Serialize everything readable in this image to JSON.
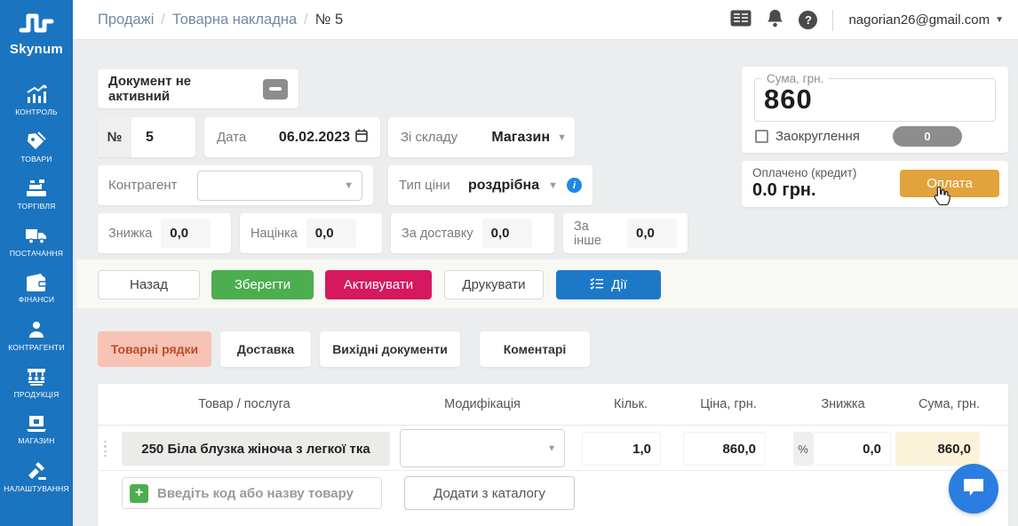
{
  "brand": {
    "name": "Skynum"
  },
  "breadcrumb": {
    "separator": "/",
    "items": [
      "Продажі",
      "Товарна накладна",
      "№ 5"
    ]
  },
  "topbar": {
    "email": "nagorian26@gmail.com",
    "help_glyph": "?",
    "icons": [
      "news-icon",
      "bell-icon",
      "help-icon"
    ]
  },
  "sidebar": {
    "items": [
      {
        "label": "КОНТРОЛЬ",
        "icon": "chart-growth-icon"
      },
      {
        "label": "ТОВАРИ",
        "icon": "price-tags-icon"
      },
      {
        "label": "ТОРГІВЛЯ",
        "icon": "cash-register-icon"
      },
      {
        "label": "ПОСТАЧАННЯ",
        "icon": "delivery-truck-icon"
      },
      {
        "label": "ФІНАНСИ",
        "icon": "wallet-icon"
      },
      {
        "label": "КОНТРАГЕНТИ",
        "icon": "person-icon"
      },
      {
        "label": "ПРОДУКЦІЯ",
        "icon": "production-icon"
      },
      {
        "label": "МАГАЗИН",
        "icon": "laptop-shop-icon"
      },
      {
        "label": "НАЛАШТУВАННЯ",
        "icon": "tools-icon"
      }
    ]
  },
  "document": {
    "status_label": "Документ не активний",
    "number_label": "№",
    "number": "5",
    "date_label": "Дата",
    "date": "06.02.2023",
    "warehouse_label": "Зі складу",
    "warehouse": "Магазин",
    "counterparty_label": "Контрагент",
    "price_type_label": "Тип ціни",
    "price_type": "роздрібна",
    "info_glyph": "i",
    "discount_label": "Знижка",
    "discount": "0,0",
    "markup_label": "Націнка",
    "markup": "0,0",
    "delivery_label": "За доставку",
    "delivery": "0,0",
    "other_label": "За інше",
    "other": "0,0"
  },
  "actions": {
    "back": "Назад",
    "save": "Зберегти",
    "activate": "Активувати",
    "print": "Друкувати",
    "more": "Дії"
  },
  "summary": {
    "total_label": "Сума, грн.",
    "total": "860",
    "rounding_label": "Заокруглення",
    "rounding_value": "0",
    "paid_label": "Оплачено (кредит)",
    "paid_value": "0.0 грн.",
    "pay_button": "Оплата"
  },
  "tabs": [
    {
      "label": "Товарні рядки",
      "active": true
    },
    {
      "label": "Доставка",
      "active": false
    },
    {
      "label": "Вихідні документи",
      "active": false
    },
    {
      "label": "Коментарі",
      "active": false
    }
  ],
  "table": {
    "headers": [
      "Товар / послуга",
      "Модифікація",
      "Кільк.",
      "Ціна, грн.",
      "Знижка",
      "Сума, грн."
    ],
    "rows": [
      {
        "product": "250 Біла блузка жіноча з легкої тка",
        "modification": "",
        "qty": "1,0",
        "price": "860,0",
        "discount_unit": "%",
        "discount": "0,0",
        "sum": "860,0"
      }
    ],
    "add_placeholder": "Введіть код або назву товару",
    "add_catalog_button": "Додати з каталогу",
    "plus_glyph": "+"
  },
  "colors": {
    "sidebar": "#1b74c0",
    "accent_blue": "#1e78c8",
    "green": "#4cae4f",
    "magenta": "#d6185e",
    "orange_pay": "#e2a23c",
    "tab_active_bg": "#f6c3b4",
    "tab_active_text": "#bf4a2b",
    "sum_highlight": "#faf3d9",
    "page_bg": "#ebedee"
  }
}
